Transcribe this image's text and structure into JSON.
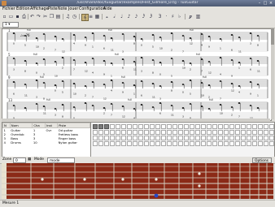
{
  "window": {
    "title": "/usr/share/doc/tuxguitar/examples/Fest_Gilmore_D.tg - TuxGuitar"
  },
  "menu": [
    "Fichier",
    "Édition",
    "Affichage",
    "Piste",
    "Note",
    "Jouer",
    "Configuration",
    "Aide"
  ],
  "toolbar": {
    "icons": [
      "new-icon",
      "open-icon",
      "save-icon",
      "print-icon",
      "undo-icon",
      "redo-icon",
      "cut-icon",
      "copy-icon",
      "paste-icon",
      "score-view-icon",
      "tab-view-icon",
      "play-icon",
      "stop-icon",
      "rewind-icon",
      "forward-icon"
    ],
    "durations": [
      "𝅝",
      "𝅗𝅥",
      "♩",
      "♪",
      "𝅘𝅥𝅯",
      "𝅘𝅥𝅰",
      "𝅘𝅥𝅱",
      "3",
      "·",
      "♯",
      "♭"
    ]
  },
  "subbar": {
    "track_selector": "1"
  },
  "score": {
    "tempo_label": "♩= 76",
    "annotations": [
      "full",
      "full",
      "full",
      "full",
      "full",
      "full",
      "full",
      "full",
      "full",
      "full",
      "full",
      "full",
      "full",
      "full"
    ],
    "measure_numbers": [
      "1",
      "5",
      "9",
      "13"
    ]
  },
  "tracks": {
    "headers": [
      "N",
      "Nom",
      "Cha",
      "Inst",
      "Piste"
    ],
    "rows": [
      [
        "1",
        "Guitar",
        "1",
        "Ovr",
        "Od guitar"
      ],
      [
        "2",
        "Overdub",
        "3",
        "",
        "Fretless bass"
      ],
      [
        "3",
        "Bass",
        "3",
        "",
        "Finger bass"
      ],
      [
        "4",
        "Drums",
        "10",
        "",
        "Nylon guitar"
      ]
    ]
  },
  "fretbar": {
    "zoom_label": "Zone",
    "zoom_value": "0",
    "mode_label": "Mode",
    "mode_value": "mode moderne",
    "settings_label": "Options"
  },
  "status": {
    "text": "Mesure 1"
  },
  "colors": {
    "titlebar": "#5a6882",
    "fretboard": "#8b2a17",
    "note_marker": "#2448c8"
  }
}
